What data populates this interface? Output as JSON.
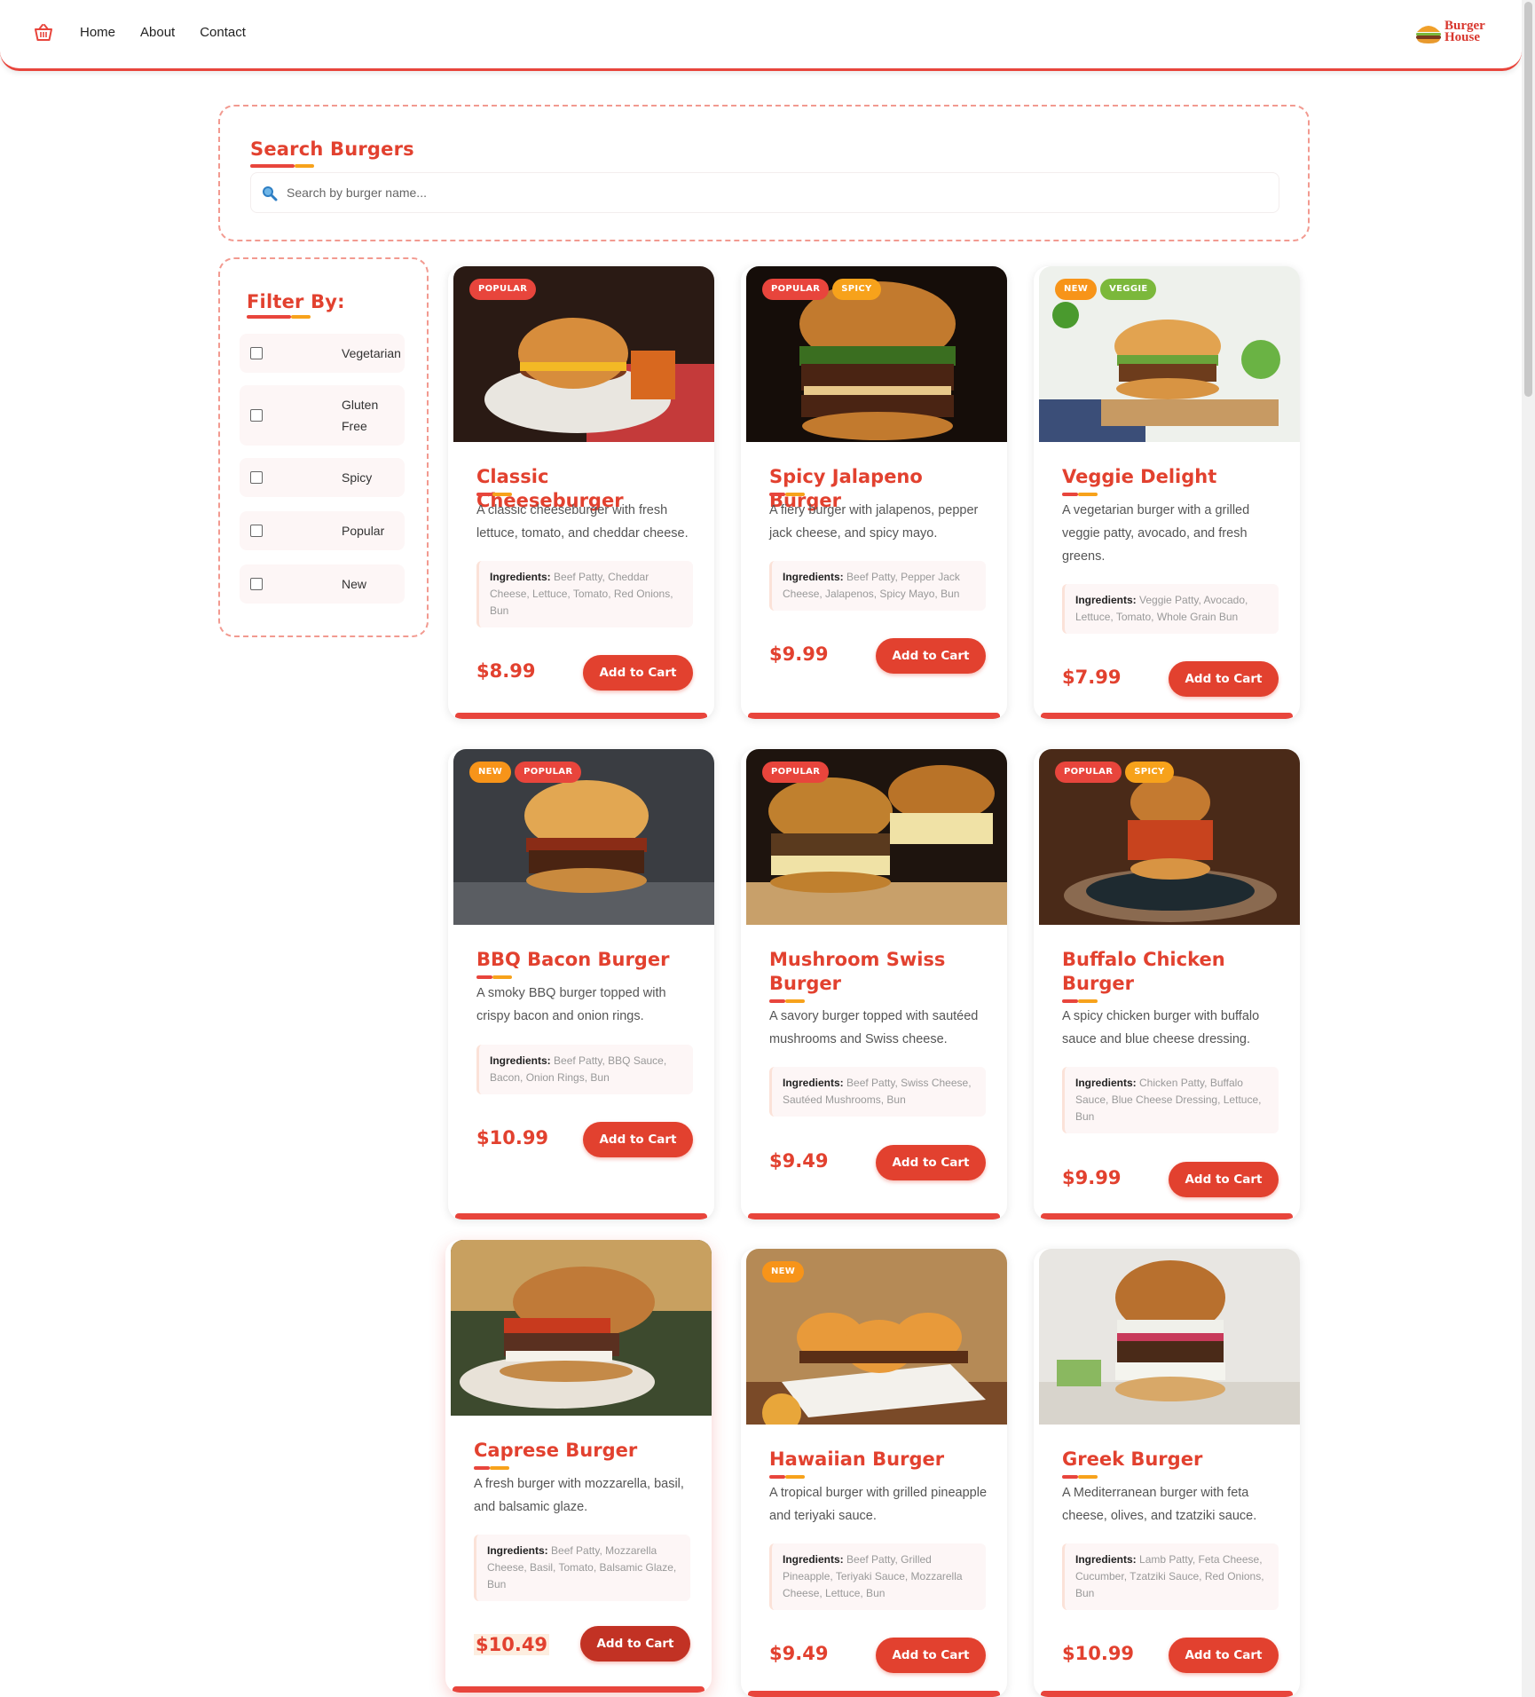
{
  "header": {
    "nav": [
      "Home",
      "About",
      "Contact"
    ],
    "logo_text": "Burger House",
    "cart_icon": "shopping-basket-icon",
    "accent": "#e8453c"
  },
  "search": {
    "title": "Search Burgers",
    "placeholder": "Search by burger name...",
    "value": "",
    "icon": "magnifier-icon"
  },
  "filter": {
    "title": "Filter By:",
    "options": [
      {
        "label": "Vegetarian",
        "checked": false
      },
      {
        "label": "Gluten Free",
        "checked": false
      },
      {
        "label": "Spicy",
        "checked": false
      },
      {
        "label": "Popular",
        "checked": false
      },
      {
        "label": "New",
        "checked": false
      }
    ]
  },
  "ingredients_label": "Ingredients:",
  "add_to_cart_label": "Add to Cart",
  "burgers": [
    {
      "name": "Classic Cheeseburger",
      "badges": [
        "POPULAR"
      ],
      "desc": "A classic cheeseburger with fresh lettuce, tomato, and cheddar cheese.",
      "ingredients": "Beef Patty, Cheddar Cheese, Lettuce, Tomato, Red Onions, Bun",
      "price": "$8.99"
    },
    {
      "name": "Spicy Jalapeno Burger",
      "badges": [
        "POPULAR",
        "SPICY"
      ],
      "desc": "A fiery burger with jalapenos, pepper jack cheese, and spicy mayo.",
      "ingredients": "Beef Patty, Pepper Jack Cheese, Jalapenos, Spicy Mayo, Bun",
      "price": "$9.99"
    },
    {
      "name": "Veggie Delight",
      "badges": [
        "NEW",
        "VEGGIE"
      ],
      "desc": "A vegetarian burger with a grilled veggie patty, avocado, and fresh greens.",
      "ingredients": "Veggie Patty, Avocado, Lettuce, Tomato, Whole Grain Bun",
      "price": "$7.99"
    },
    {
      "name": "BBQ Bacon Burger",
      "badges": [
        "NEW",
        "POPULAR"
      ],
      "desc": "A smoky BBQ burger topped with crispy bacon and onion rings.",
      "ingredients": "Beef Patty, BBQ Sauce, Bacon, Onion Rings, Bun",
      "price": "$10.99"
    },
    {
      "name": "Mushroom Swiss Burger",
      "badges": [
        "POPULAR"
      ],
      "desc": "A savory burger topped with sautéed mushrooms and Swiss cheese.",
      "ingredients": "Beef Patty, Swiss Cheese, Sautéed Mushrooms, Bun",
      "price": "$9.49"
    },
    {
      "name": "Buffalo Chicken Burger",
      "badges": [
        "POPULAR",
        "SPICY"
      ],
      "desc": "A spicy chicken burger with buffalo sauce and blue cheese dressing.",
      "ingredients": "Chicken Patty, Buffalo Sauce, Blue Cheese Dressing, Lettuce, Bun",
      "price": "$9.99"
    },
    {
      "name": "Caprese Burger",
      "badges": [],
      "desc": "A fresh burger with mozzarella, basil, and balsamic glaze.",
      "ingredients": "Beef Patty, Mozzarella Cheese, Basil, Tomato, Balsamic Glaze, Bun",
      "price": "$10.49"
    },
    {
      "name": "Hawaiian Burger",
      "badges": [
        "NEW"
      ],
      "desc": "A tropical burger with grilled pineapple and teriyaki sauce.",
      "ingredients": "Beef Patty, Grilled Pineapple, Teriyaki Sauce, Mozzarella Cheese, Lettuce, Bun",
      "price": "$9.49"
    },
    {
      "name": "Greek Burger",
      "badges": [],
      "desc": "A Mediterranean burger with feta cheese, olives, and tzatziki sauce.",
      "ingredients": "Lamb Patty, Feta Cheese, Cucumber, Tzatziki Sauce, Red Onions, Bun",
      "price": "$10.99"
    }
  ]
}
